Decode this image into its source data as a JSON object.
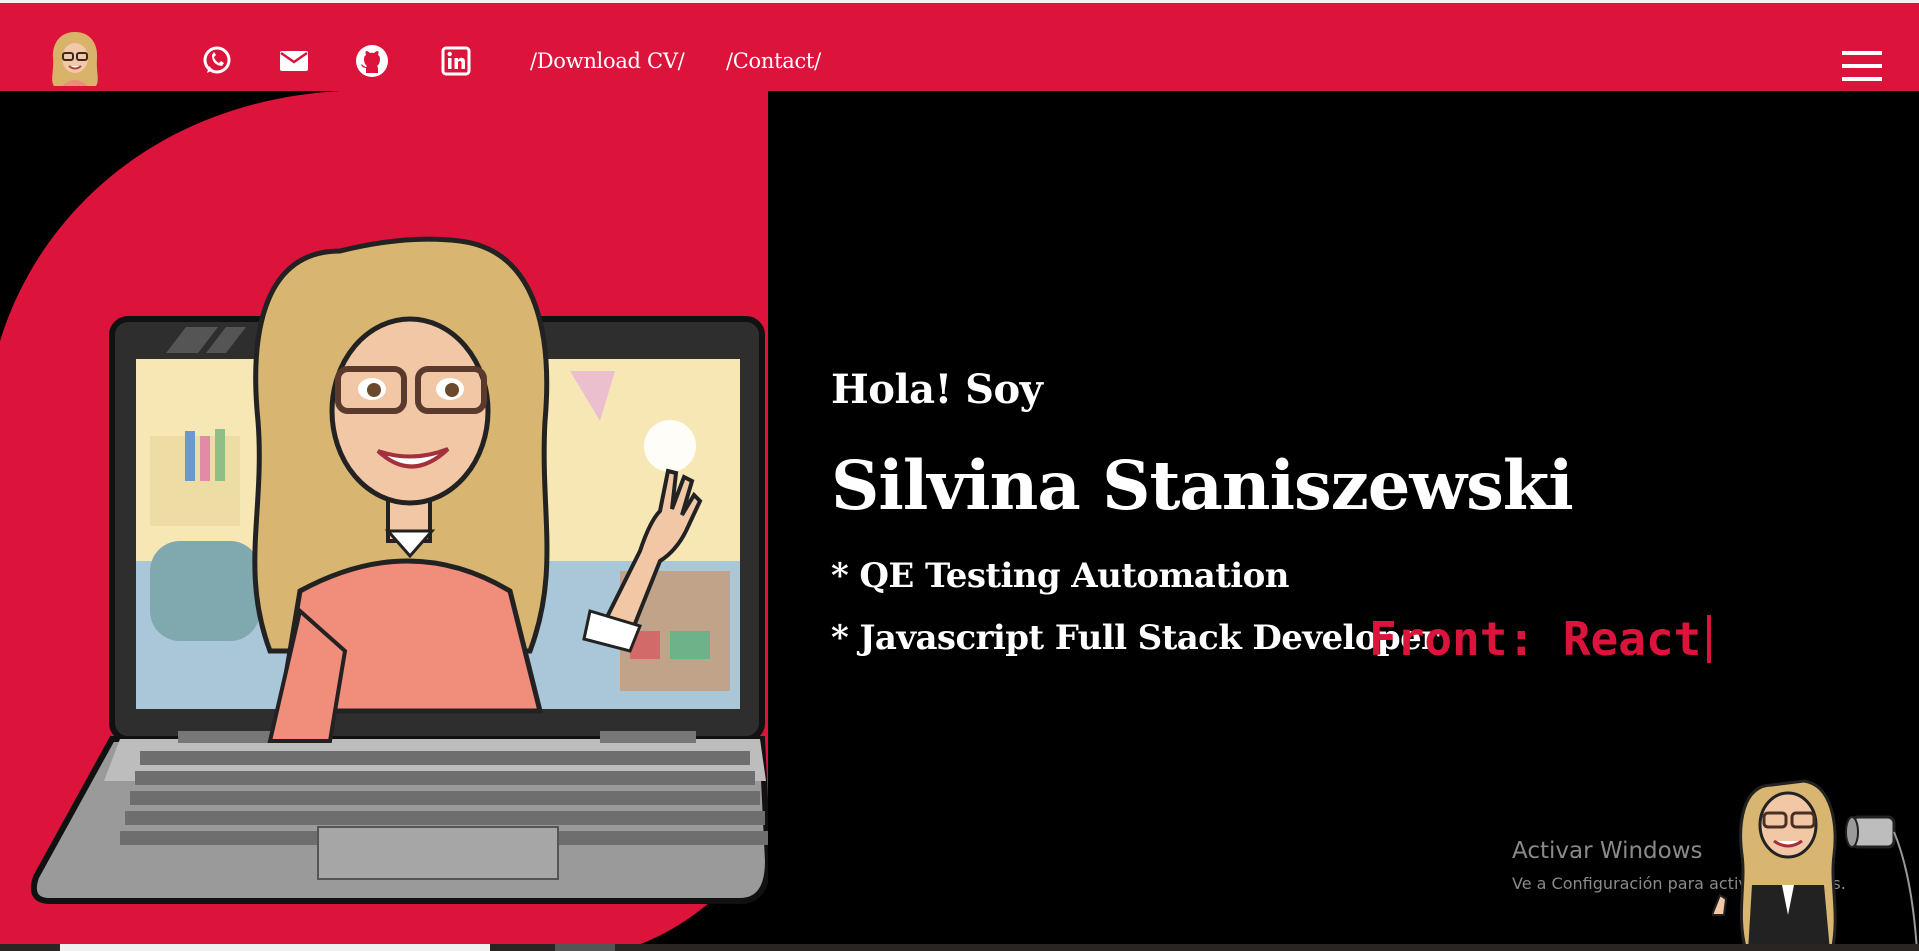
{
  "nav": {
    "links": [
      {
        "label": "/Download CV/"
      },
      {
        "label": "/Contact/"
      }
    ],
    "icons": [
      "whatsapp-icon",
      "email-icon",
      "github-icon",
      "linkedin-icon"
    ],
    "menu_icon": "hamburger-menu-icon"
  },
  "hero": {
    "greeting": "Hola! Soy",
    "name": "Silvina Staniszewski",
    "roles": [
      "* QE Testing Automation",
      "* Javascript Full Stack Developer"
    ],
    "typed_text": "Front: React"
  },
  "os_watermark": {
    "title": "Activar Windows",
    "subtitle": "Ve a Configuración para activar Windows."
  },
  "colors": {
    "brand_red": "#dc143c",
    "background": "#000000",
    "text": "#ffffff"
  }
}
